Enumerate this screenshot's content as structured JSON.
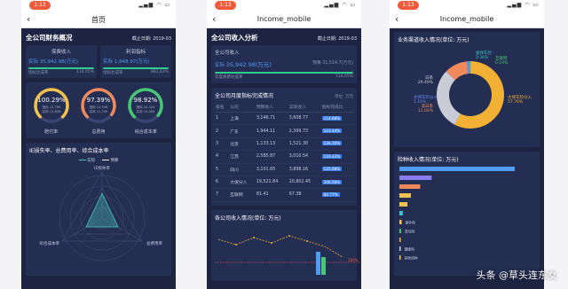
{
  "status_time": "1:13",
  "status_icons": "▂▄▆ ◠ ▭",
  "screen1": {
    "nav_title": "首页",
    "section_title": "全公司财务概况",
    "date_label": "截止日期: 2019-03",
    "card_left": {
      "title": "保费收入",
      "actual_label": "实际",
      "actual_value": "35,942.98(万元)",
      "progress_label": "指标达成率",
      "progress_pct": "114.05%",
      "progress": 1.0
    },
    "card_right": {
      "title": "利润指标",
      "actual_label": "实际",
      "actual_value": "1,848.97(万元)",
      "progress_label": "指标达成率",
      "progress_pct": "881.63%",
      "progress": 1.0
    },
    "gauges": [
      {
        "pct": "100.29%",
        "label": "赔付率",
        "row1": "指标 12,789",
        "row2": "实际 12,826",
        "color": "#f2c14e",
        "fill": 0.75
      },
      {
        "pct": "97.39%",
        "label": "总费用",
        "row1": "指标 11,536",
        "row2": "实际 11,239",
        "color": "#f08a5d",
        "fill": 0.72
      },
      {
        "pct": "98.92%",
        "label": "综合成本率",
        "row1": "指标 24,324",
        "row2": "实际 24,065",
        "color": "#48c774",
        "fill": 0.73
      }
    ],
    "radar_title": "IE损失率、总费用率、综合成本率",
    "legend_actual": "实际",
    "legend_target": "预算",
    "radar_axes": [
      "IE损失率",
      "总费用率",
      "综合成本率"
    ]
  },
  "screen2": {
    "nav_title": "Income_mobile",
    "section_title": "全公司收入分析",
    "date_label": "截止日期: 2019-03",
    "income_card_title": "全公司收入",
    "actual_label": "实际",
    "actual_value": "35,942.98(万元)",
    "budget_label": "预算",
    "budget_value": "31,514.7(万元)",
    "progress_label": "年度保费达成率",
    "progress_pct": "114.05%",
    "progress": 1.0,
    "table_title": "全公司月度指标完成情况",
    "unit_label": "单位: 万元",
    "columns": [
      "排名",
      "公司",
      "预算收入",
      "实际收入",
      "指标完成比"
    ],
    "rows": [
      {
        "rank": "1",
        "company": "上海",
        "budget": "3,146.71",
        "actual": "3,608.77",
        "ratio": "114.68%"
      },
      {
        "rank": "2",
        "company": "广东",
        "budget": "1,944.11",
        "actual": "2,399.73",
        "ratio": "123.44%"
      },
      {
        "rank": "3",
        "company": "北京",
        "budget": "1,133.13",
        "actual": "1,521.30",
        "ratio": "134.26%"
      },
      {
        "rank": "4",
        "company": "江苏",
        "budget": "2,585.87",
        "actual": "3,010.54",
        "ratio": "116.42%"
      },
      {
        "rank": "5",
        "company": "四川",
        "budget": "3,101.65",
        "actual": "3,898.16",
        "ratio": "125.68%"
      },
      {
        "rank": "6",
        "company": "大保分入",
        "budget": "19,521.84",
        "actual": "20,802.45",
        "ratio": "106.56%"
      },
      {
        "rank": "7",
        "company": "互联网",
        "budget": "81.41",
        "actual": "67.38",
        "ratio": "82.77%"
      }
    ],
    "monthly_title": "各公司收入情况(单位: 万元)",
    "monthly_marker": "100%"
  },
  "screen3": {
    "nav_title": "Income_mobile",
    "donut_title": "业务渠道收入情况(单位: 万元)",
    "chart_data": {
      "type": "pie",
      "slices": [
        {
          "name": "大保车险分入",
          "pct": "57.76%",
          "value": 57.76,
          "color": "#f2b134"
        },
        {
          "name": "日系",
          "pct": "29.49%",
          "value": 29.49,
          "color": "#c9cbd6"
        },
        {
          "name": "非日系",
          "pct": "11.04%",
          "value": 11.04,
          "color": "#f08a5d"
        },
        {
          "name": "太保车险分入",
          "pct": "1.16%",
          "value": 1.16,
          "color": "#6a8ef2"
        },
        {
          "name": "壹保车险",
          "pct": "0.36%",
          "value": 0.36,
          "color": "#3ec1c9"
        },
        {
          "name": "互联网",
          "pct": "0.19%",
          "value": 0.19,
          "color": "#48c774"
        }
      ]
    },
    "bar_title": "险种收入情况(单位: 万元)",
    "hbars": [
      {
        "value": 1.0,
        "color": "#4f9cf5",
        "label": ""
      },
      {
        "value": 0.28,
        "color": "#8a7cf0",
        "label": ""
      },
      {
        "value": 0.18,
        "color": "#f08a5d",
        "label": ""
      },
      {
        "value": 0.1,
        "color": "#f2c14e",
        "label": ""
      },
      {
        "value": 0.07,
        "color": "#f2c14e",
        "label": ""
      },
      {
        "value": 0.03,
        "color": "#3ec1c9",
        "label": ""
      },
      {
        "value": 0.02,
        "color": "#f2c14e",
        "label": "意外险"
      },
      {
        "value": 0.015,
        "color": "#48c774",
        "label": "责任险"
      },
      {
        "value": 0.012,
        "color": "#f2b134",
        "label": ""
      },
      {
        "value": 0.01,
        "color": "#c9cbd6",
        "label": "健康险"
      },
      {
        "value": 0.008,
        "color": "#f2c14e",
        "label": "其他险种"
      }
    ]
  },
  "watermark": "头条 @草头连东女"
}
